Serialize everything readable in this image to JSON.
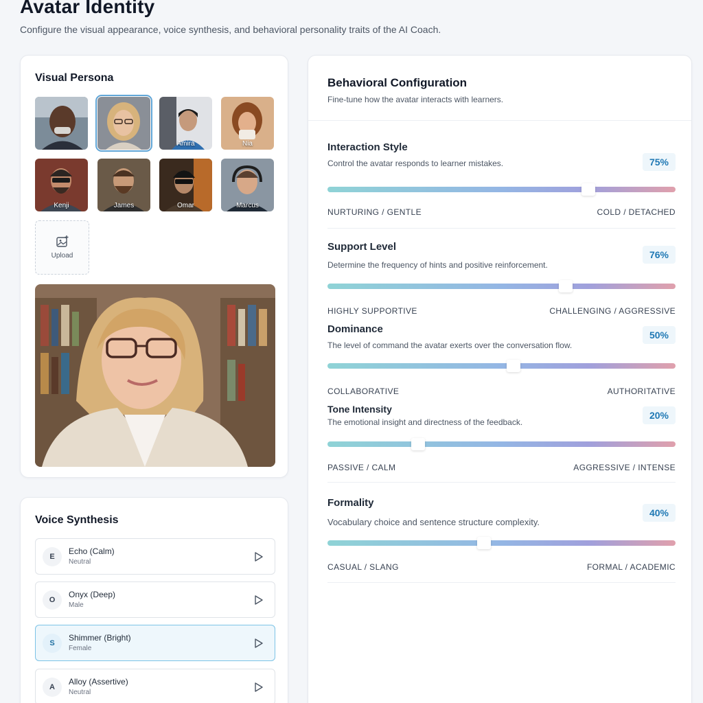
{
  "page": {
    "title": "Avatar Identity",
    "subtitle": "Configure the visual appearance, voice synthesis, and behavioral personality traits of the AI Coach."
  },
  "persona": {
    "title": "Visual Persona",
    "avatars": [
      {
        "name": ""
      },
      {
        "name": ""
      },
      {
        "name": "Amira"
      },
      {
        "name": "Nia"
      },
      {
        "name": "Kenji"
      },
      {
        "name": "James"
      },
      {
        "name": "Omar"
      },
      {
        "name": "Marcus"
      }
    ],
    "upload_label": "Upload"
  },
  "voice": {
    "title": "Voice Synthesis",
    "items": [
      {
        "badge": "E",
        "name": "Echo (Calm)",
        "type": "Neutral"
      },
      {
        "badge": "O",
        "name": "Onyx (Deep)",
        "type": "Male"
      },
      {
        "badge": "S",
        "name": "Shimmer (Bright)",
        "type": "Female"
      },
      {
        "badge": "A",
        "name": "Alloy (Assertive)",
        "type": "Neutral"
      }
    ]
  },
  "behavior": {
    "title": "Behavioral Configuration",
    "subtitle": "Fine-tune how the avatar interacts with learners.",
    "traits": [
      {
        "name": "Interaction Style",
        "desc": "Control the avatar responds to learner mistakes.",
        "value_label": "75%",
        "value": 0.75,
        "left": "NURTURING / GENTLE",
        "right": "COLD / DETACHED"
      },
      {
        "name": "Support Level",
        "desc": "Determine the frequency of hints and positive reinforcement.",
        "value_label": "76%",
        "value": 0.685,
        "left": "HIGHLY SUPPORTIVE",
        "right": "CHALLENGING / AGGRESSIVE"
      },
      {
        "name": "Dominance",
        "desc": "The level of command the avatar exerts over the conversation flow.",
        "value_label": "50%",
        "value": 0.535,
        "left": "COLLABORATIVE",
        "right": "AUTHORITATIVE"
      },
      {
        "name": "Tone Intensity",
        "desc": "The emotional insight and directness of the feedback.",
        "value_label": "20%",
        "value": 0.26,
        "left": "PASSIVE / CALM",
        "right": "AGGRESSIVE / INTENSE"
      },
      {
        "name": "Formality",
        "desc": "Vocabulary choice and sentence structure complexity.",
        "value_label": "40%",
        "value": 0.45,
        "left": "CASUAL / SLANG",
        "right": "FORMAL / ACADEMIC"
      }
    ]
  },
  "colors": {
    "accent": "#1f78b4",
    "selected_border": "#7cc3e6",
    "track_start": "#8fd3d6",
    "track_end": "#e0a0ac"
  }
}
